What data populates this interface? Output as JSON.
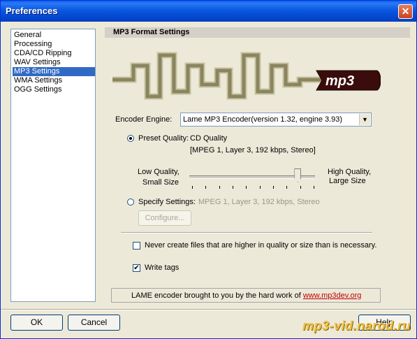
{
  "window": {
    "title": "Preferences"
  },
  "sidebar": {
    "items": [
      {
        "label": "General",
        "selected": false
      },
      {
        "label": "Processing",
        "selected": false
      },
      {
        "label": "CDA/CD Ripping",
        "selected": false
      },
      {
        "label": "WAV Settings",
        "selected": false
      },
      {
        "label": "MP3 Settings",
        "selected": true
      },
      {
        "label": "WMA Settings",
        "selected": false
      },
      {
        "label": "OGG Settings",
        "selected": false
      }
    ]
  },
  "panel": {
    "heading": "MP3 Format Settings",
    "logo_text": "mp3",
    "encoder": {
      "label": "Encoder Engine:",
      "value": "Lame MP3 Encoder(version 1.32, engine 3.93)"
    },
    "preset": {
      "label": "Preset Quality:",
      "value": "CD Quality",
      "detail": "[MPEG 1, Layer 3, 192 kbps, Stereo]",
      "selected": true
    },
    "slider": {
      "low_label_1": "Low Quality,",
      "low_label_2": "Small Size",
      "high_label_1": "High Quality,",
      "high_label_2": "Large Size",
      "position": 0.87,
      "tick_count": 10
    },
    "specify": {
      "label": "Specify Settings:",
      "value": "MPEG 1, Layer 3, 192 kbps, Stereo",
      "selected": false,
      "configure_label": "Configure..."
    },
    "never_create": {
      "label": "Never create files that are higher in quality or size than is necessary.",
      "checked": false
    },
    "write_tags": {
      "label": "Write tags",
      "checked": true
    },
    "credit": {
      "text": "LAME encoder brought to you by the hard work of",
      "link": "www.mp3dev.org"
    }
  },
  "footer": {
    "ok_label": "OK",
    "cancel_label": "Cancel",
    "help_label": "Help",
    "watermark": "mp3-vid.narod.ru"
  },
  "colors": {
    "title_bar": "#0a58e0",
    "selection": "#316ac5",
    "logo_olive": "#a7a27a",
    "logo_badge": "#3a0c0c",
    "link": "#c00000"
  }
}
